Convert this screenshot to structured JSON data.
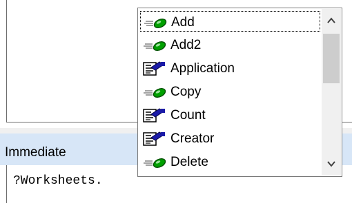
{
  "editor": {
    "code": ""
  },
  "immediate": {
    "title": "Immediate",
    "input_value": "?Worksheets."
  },
  "autocomplete": {
    "items": [
      {
        "label": "Add",
        "icon": "method-icon",
        "selected": true
      },
      {
        "label": "Add2",
        "icon": "method-icon",
        "selected": false
      },
      {
        "label": "Application",
        "icon": "property-icon",
        "selected": false
      },
      {
        "label": "Copy",
        "icon": "method-icon",
        "selected": false
      },
      {
        "label": "Count",
        "icon": "property-icon",
        "selected": false
      },
      {
        "label": "Creator",
        "icon": "property-icon",
        "selected": false
      },
      {
        "label": "Delete",
        "icon": "method-icon",
        "selected": false
      }
    ],
    "scroll_position": 0
  },
  "colors": {
    "titlebar": "#d7e6f7",
    "method_green": "#00a000",
    "property_blue": "#1a1aa8"
  }
}
